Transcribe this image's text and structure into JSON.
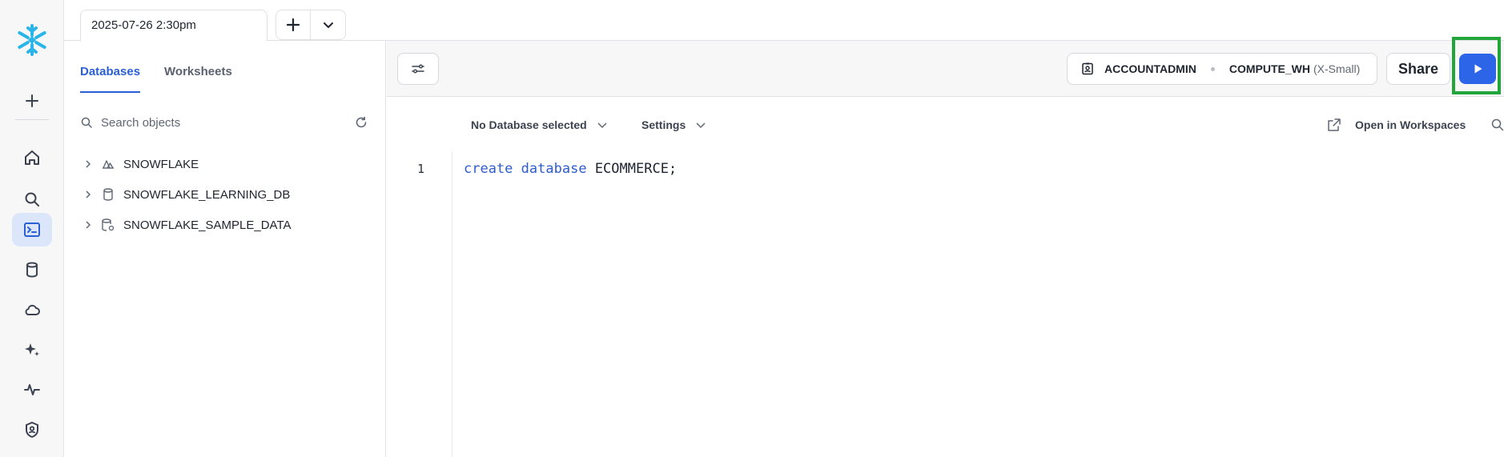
{
  "rail": {
    "items": [
      {
        "name": "add",
        "icon": "plus-icon"
      },
      {
        "name": "home",
        "icon": "home-icon"
      },
      {
        "name": "search",
        "icon": "search-icon"
      },
      {
        "name": "projects",
        "icon": "terminal-icon",
        "active": true
      },
      {
        "name": "data",
        "icon": "database-icon"
      },
      {
        "name": "data-products",
        "icon": "cloud-icon"
      },
      {
        "name": "ai-ml",
        "icon": "sparkle-icon"
      },
      {
        "name": "monitoring",
        "icon": "activity-icon"
      },
      {
        "name": "governance",
        "icon": "shield-icon"
      }
    ]
  },
  "topbar": {
    "worksheet_tab": "2025-07-26 2:30pm"
  },
  "sidebar": {
    "tabs": [
      {
        "label": "Databases",
        "active": true
      },
      {
        "label": "Worksheets",
        "active": false
      }
    ],
    "search_placeholder": "Search objects",
    "databases": [
      {
        "label": "SNOWFLAKE",
        "icon": "shared-db-icon"
      },
      {
        "label": "SNOWFLAKE_LEARNING_DB",
        "icon": "database-icon"
      },
      {
        "label": "SNOWFLAKE_SAMPLE_DATA",
        "icon": "shared-database-icon"
      }
    ]
  },
  "toolbar": {
    "role": "ACCOUNTADMIN",
    "warehouse": "COMPUTE_WH",
    "warehouse_size": "(X-Small)",
    "share_label": "Share"
  },
  "editor": {
    "database_select": "No Database selected",
    "settings_label": "Settings",
    "open_workspaces_label": "Open in Workspaces",
    "line_number": "1",
    "code": {
      "kw1": "create",
      "kw2": "database",
      "rest": "ECOMMERCE;"
    }
  },
  "colors": {
    "accent": "#2d65e8",
    "active_tab": "#2a5fd6",
    "highlight": "#22a53a",
    "keyword": "#2d5ccf"
  }
}
